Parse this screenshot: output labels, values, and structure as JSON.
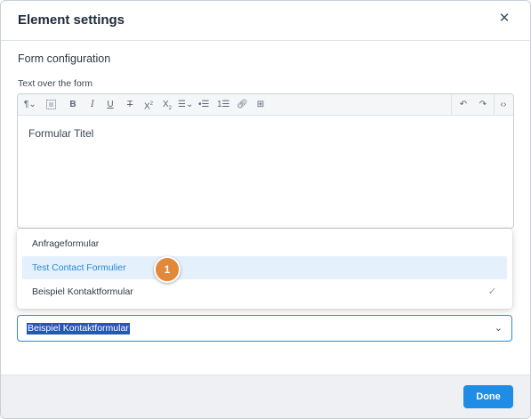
{
  "dialog": {
    "title": "Element settings",
    "close_icon": "close-icon"
  },
  "form": {
    "section_title": "Form configuration",
    "text_label": "Text over the form",
    "editor_content": "Formular Titel"
  },
  "toolbar": {
    "icons": [
      "paragraph-icon",
      "special-char-icon",
      "bold-icon",
      "italic-icon",
      "underline-icon",
      "strikethrough-icon",
      "superscript-icon",
      "subscript-icon",
      "align-icon",
      "unordered-list-icon",
      "ordered-list-icon",
      "link-icon",
      "table-icon",
      "undo-icon",
      "redo-icon",
      "code-view-icon"
    ]
  },
  "dropdown": {
    "options": [
      {
        "label": "Anfrageformular",
        "highlighted": false,
        "selected": false
      },
      {
        "label": "Test Contact Formulier",
        "highlighted": true,
        "selected": false
      },
      {
        "label": "Beispiel Kontaktformular",
        "highlighted": false,
        "selected": true
      }
    ],
    "step_badge": "1"
  },
  "select": {
    "value": "Beispiel Kontaktformular"
  },
  "footer": {
    "done_label": "Done"
  },
  "colors": {
    "accent": "#1f8de6",
    "highlight_bg": "#e4f1fd",
    "badge": "#e2883a",
    "selection_bg": "#2357b8"
  }
}
